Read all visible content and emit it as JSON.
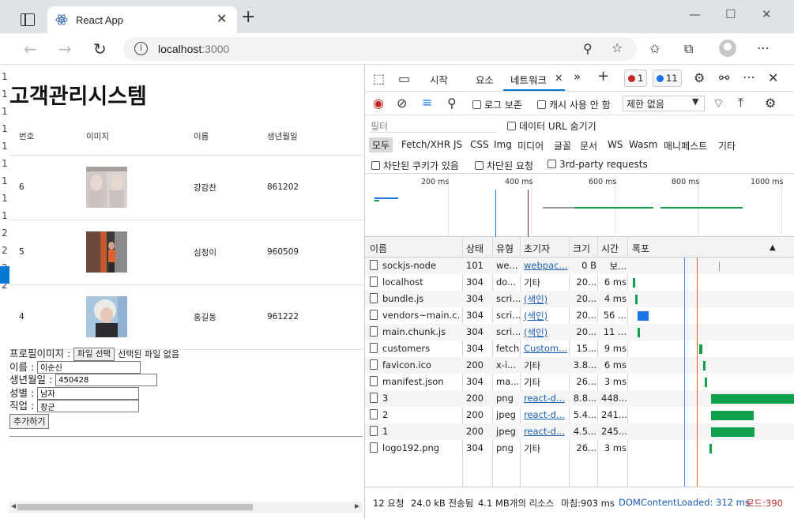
{
  "browser": {
    "tab_title": "React App",
    "url_host": "localhost",
    "url_port": ":3000"
  },
  "page": {
    "title": "고객관리시스템",
    "gutter_digits": [
      "1",
      "1",
      "1",
      "1",
      "1",
      "1",
      "1",
      "1",
      "1",
      "2",
      "2",
      "2",
      "2"
    ],
    "table": {
      "headers": [
        "번호",
        "이미지",
        "이름",
        "생년월일"
      ],
      "rows": [
        {
          "id": "6",
          "name": "강감찬",
          "birth": "861202"
        },
        {
          "id": "5",
          "name": "심청이",
          "birth": "960509"
        },
        {
          "id": "4",
          "name": "홍길동",
          "birth": "961222"
        }
      ]
    },
    "form": {
      "profile_label": "프로필이미지 :",
      "file_button": "파일 선택",
      "file_status": "선택된 파일 없음",
      "name_label": "이름 :",
      "name_value": "이순신",
      "birth_label": "생년월일 :",
      "birth_value": "450428",
      "gender_label": "성별 :",
      "gender_value": "남자",
      "job_label": "직업 :",
      "job_value": "장군",
      "submit": "추가하기"
    }
  },
  "devtools": {
    "tabs": [
      "시작",
      "요소",
      "네트워크"
    ],
    "active_tab": "네트워크",
    "errors": "1",
    "messages": "11",
    "preserve_log": "로그 보존",
    "disable_cache": "캐시 사용 안 함",
    "throttle": "제한 없음",
    "filter_placeholder": "필터",
    "hide_data_urls": "데이터 URL 숨기기",
    "types": [
      "모두",
      "Fetch/XHR",
      "JS",
      "CSS",
      "Img",
      "미디어",
      "글꼴",
      "문서",
      "WS",
      "Wasm",
      "매니페스트",
      "기타"
    ],
    "blocked_cookies": "차단된 쿠키가 있음",
    "blocked_requests": "차단된 요청",
    "third_party": "3rd-party requests",
    "overview_ticks": [
      "200 ms",
      "400 ms",
      "600 ms",
      "800 ms",
      "1000 ms"
    ],
    "columns": [
      "이름",
      "상태",
      "유형",
      "초기자",
      "크기",
      "시간",
      "폭포"
    ],
    "requests": [
      {
        "name": "sockjs-node",
        "status": "101",
        "type": "we...",
        "initiator": "webpac...",
        "size": "0 B",
        "time": "보..."
      },
      {
        "name": "localhost",
        "status": "304",
        "type": "do...",
        "initiator": "기타",
        "size": "20...",
        "time": "6 ms"
      },
      {
        "name": "bundle.js",
        "status": "304",
        "type": "scri...",
        "initiator": "(색인)",
        "size": "20...",
        "time": "4 ms"
      },
      {
        "name": "vendors~main.c...",
        "status": "304",
        "type": "scri...",
        "initiator": "(색인)",
        "size": "20...",
        "time": "56 ..."
      },
      {
        "name": "main.chunk.js",
        "status": "304",
        "type": "scri...",
        "initiator": "(색인)",
        "size": "20...",
        "time": "11 ..."
      },
      {
        "name": "customers",
        "status": "304",
        "type": "fetch",
        "initiator": "Custom...",
        "size": "15...",
        "time": "9 ms"
      },
      {
        "name": "favicon.ico",
        "status": "200",
        "type": "x-i...",
        "initiator": "기타",
        "size": "3.8...",
        "time": "6 ms"
      },
      {
        "name": "manifest.json",
        "status": "304",
        "type": "ma...",
        "initiator": "기타",
        "size": "26...",
        "time": "3 ms"
      },
      {
        "name": "3",
        "status": "200",
        "type": "png",
        "initiator": "react-d...",
        "size": "8.8...",
        "time": "448..."
      },
      {
        "name": "2",
        "status": "200",
        "type": "jpeg",
        "initiator": "react-d...",
        "size": "5.4...",
        "time": "241..."
      },
      {
        "name": "1",
        "status": "200",
        "type": "jpeg",
        "initiator": "react-d...",
        "size": "4.5...",
        "time": "245..."
      },
      {
        "name": "logo192.png",
        "status": "304",
        "type": "png",
        "initiator": "기타",
        "size": "26...",
        "time": "3 ms"
      }
    ],
    "summary": {
      "requests": "12 요청",
      "transferred": "24.0 kB 전송됨",
      "resources": "4.1 MB개의 리소스",
      "finish": "마침:903 ms",
      "dcl": "DOMContentLoaded: 312 ms",
      "load": "로드:390"
    },
    "colors": {
      "accent": "#0078d4",
      "bar_green": "#0fa14a",
      "bar_blue": "#1a73e8",
      "dcl_line": "#4a90e2",
      "load_line": "#d9622b"
    }
  }
}
